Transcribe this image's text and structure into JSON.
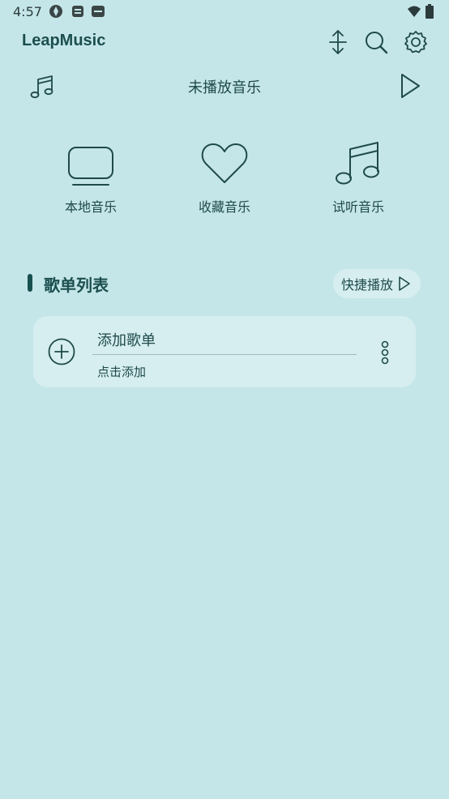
{
  "status_bar": {
    "time": "4:57",
    "icons": [
      "app-icon",
      "app-icon",
      "app-icon",
      "wifi-icon",
      "battery-icon"
    ]
  },
  "app_bar": {
    "title": "LeapMusic",
    "actions": [
      "sort-icon",
      "search-icon",
      "gear-icon"
    ]
  },
  "now_playing": {
    "title": "未播放音乐"
  },
  "quick_access": [
    {
      "label": "本地音乐",
      "icon": "monitor-icon"
    },
    {
      "label": "收藏音乐",
      "icon": "heart-icon"
    },
    {
      "label": "试听音乐",
      "icon": "music-note-icon"
    }
  ],
  "playlist_section": {
    "title": "歌单列表",
    "quick_play_label": "快捷播放",
    "items": [
      {
        "title": "添加歌单",
        "subtitle": "点击添加"
      }
    ]
  },
  "colors": {
    "background": "#c5e6e9",
    "card": "#d6eef0",
    "accent": "#17504f",
    "text": "#1f4a4a"
  }
}
